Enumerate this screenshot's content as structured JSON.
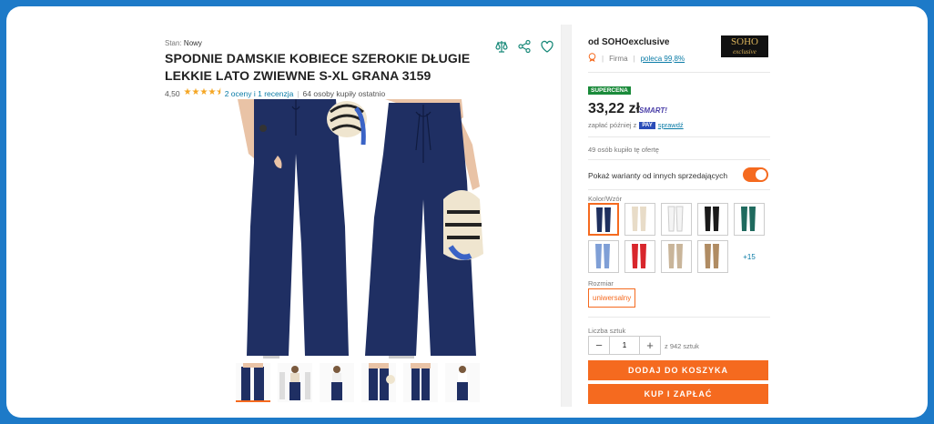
{
  "product": {
    "condition_label": "Stan:",
    "condition_value": "Nowy",
    "title": "SPODNIE DAMSKIE KOBIECE SZEROKIE DŁUGIE LEKKIE LATO ZWIEWNE S-XL GRANA 3159",
    "rating_value": "4,50",
    "rating_stars": 4.5,
    "ratings_link": "2 oceny i 1 recenzja",
    "bought_recent": "64 osoby kupiły ostatnio",
    "icons": [
      "compare-icon",
      "share-icon",
      "heart-icon"
    ],
    "thumbnail_count": 6
  },
  "seller": {
    "name": "od SOHOexclusive",
    "type": "Firma",
    "recommend": "poleca 99,8%",
    "logo_line1": "SOHO",
    "logo_line2": "exclusive"
  },
  "offer": {
    "badge": "SUPERCENA",
    "price": "33,22 zł",
    "smart_label": "SMART!",
    "pay_later": "zapłać później z",
    "pay_logo": "PAY",
    "pay_link": "sprawdź",
    "bought_offer": "49 osób kupiło tę ofertę",
    "variants_toggle_label": "Pokaż warianty od innych sprzedających",
    "variants_toggle_on": true,
    "color_label": "Kolor/Wzór",
    "color_swatches": [
      "#1e2f5e",
      "#e8dcc8",
      "#f4f4f4",
      "#1a1a1a",
      "#1f6a5e",
      "#7f9fd6",
      "#d8262c",
      "#c9b59a",
      "#b08c63"
    ],
    "more_colors": "+15",
    "size_label": "Rozmiar",
    "size_value": "uniwersalny",
    "qty_label": "Liczba sztuk",
    "qty_value": "1",
    "stock": "z 942 sztuk",
    "add_to_cart": "DODAJ DO KOSZYKA",
    "buy_now": "KUP I ZAPŁAĆ"
  },
  "colors": {
    "accent": "#f56a1f",
    "frame": "#1d7ac8",
    "link": "#0a7ba6",
    "badge": "#1a8a3a"
  }
}
